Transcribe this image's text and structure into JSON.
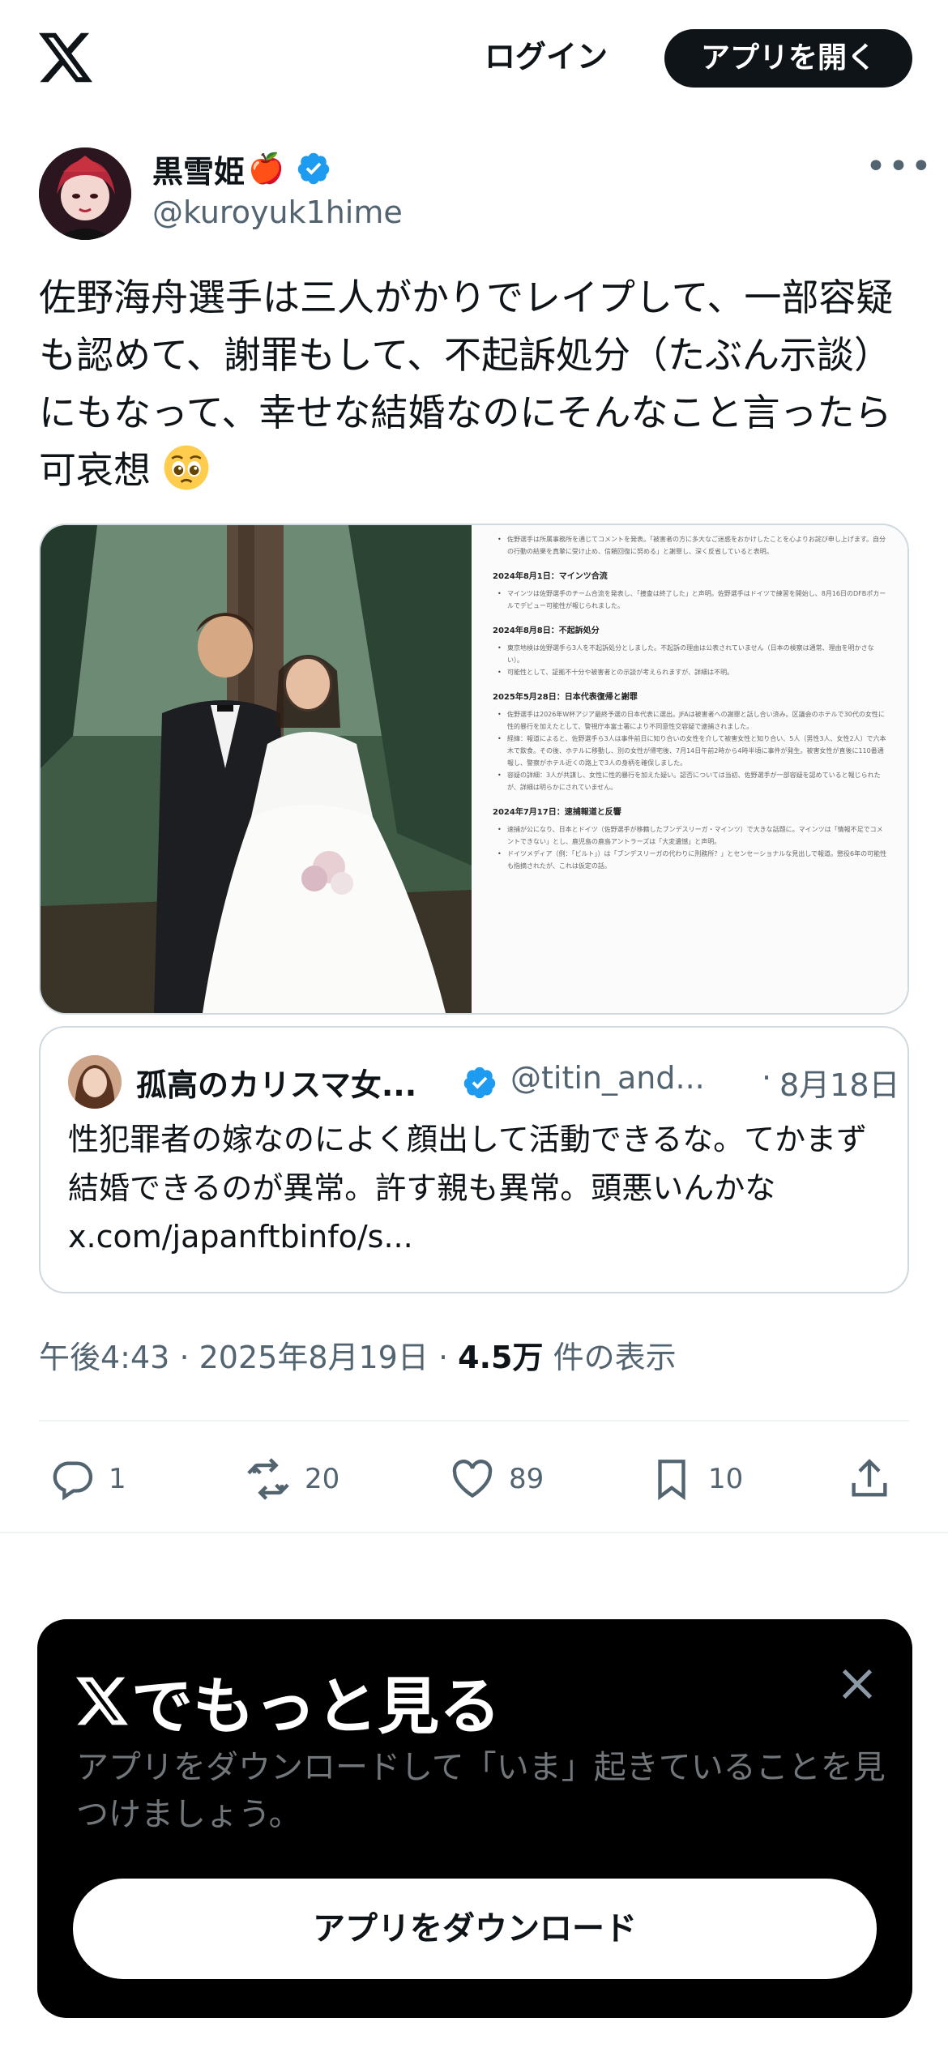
{
  "header": {
    "logo_icon": "x-logo-icon",
    "login_label": "ログイン",
    "open_app_label": "アプリを開く"
  },
  "tweet": {
    "author_name": "黒雪姫",
    "author_emoji": "🍎",
    "author_handle": "@kuroyuk1hime",
    "text_main": "佐野海舟選手は三人がかりでレイプして、一部容疑も認めて、謝罪もして、不起訴処分（たぶん示談）にもなって、幸せな結婚なのにそんなこと言ったら可哀想",
    "text_emoji": "pleading-face-emoji",
    "time": "午後4:43",
    "date": "2025年8月19日",
    "views_count": "4.5万",
    "views_label": "件の表示",
    "sep": "·"
  },
  "media_doc": {
    "lines": [
      {
        "kind": "p",
        "text": "佐野選手は所属事務所を通じてコメントを発表。「被害者の方に多大なご迷惑をおかけしたことを心よりお詫び申し上げます。自分の行動の結果を真摯に受け止め、信頼回復に努める」と謝罪し、深く反省していると表明。"
      },
      {
        "kind": "h",
        "text": "2024年8月1日：マインツ合流"
      },
      {
        "kind": "p",
        "text": "マインツは佐野選手のチーム合流を発表し、「捜査は終了した」と声明。佐野選手はドイツで練習を開始し、8月16日のDFBポカールでデビュー可能性が報じられました。"
      },
      {
        "kind": "h",
        "text": "2024年8月8日：不起訴処分"
      },
      {
        "kind": "p",
        "text": "東京地検は佐野選手ら3人を不起訴処分としました。不起訴の理由は公表されていません（日本の検察は通常、理由を明かさない）。"
      },
      {
        "kind": "p",
        "text": "可能性として、証拠不十分や被害者との示談が考えられますが、詳細は不明。"
      },
      {
        "kind": "h",
        "text": "2025年5月28日：日本代表復帰と謝罪"
      },
      {
        "kind": "p",
        "text": "佐野選手は2026年W杯アジア最終予選の日本代表に選出。JFAは被害者への謝罪と話し合い済み。区議会のホテルで30代の女性に性的暴行を加えたとして、警視庁本富士署により不同意性交容疑で逮捕されました。"
      },
      {
        "kind": "p",
        "text": "経緯：報道によると、佐野選手ら3人は事件前日に知り合いの女性を介して被害女性と知り合い、5人（男性3人、女性2人）で六本木で飲食。その後、ホテルに移動し、別の女性が帰宅後、7月14日午前2時から4時半頃に事件が発生。被害女性が直後に110番通報し、警察がホテル近くの路上で3人の身柄を確保しました。"
      },
      {
        "kind": "p",
        "text": "容疑の詳細：3人が共謀し、女性に性的暴行を加えた疑い。認否については当初、佐野選手が一部容疑を認めていると報じられたが、詳細は明らかにされていません。"
      },
      {
        "kind": "h",
        "text": "2024年7月17日：速捕報道と反響"
      },
      {
        "kind": "p",
        "text": "速捕が公になり、日本とドイツ（佐野選手が移籍したブンデスリーガ・マインツ）で大きな話題に。マインツは「情報不足でコメントできない」とし、鹿児島の鹿島アントラーズは「大変遺憾」と声明。"
      },
      {
        "kind": "p",
        "text": "ドイツメディア（例：「ビルト」）は「ブンデスリーガの代わりに刑務所？」とセンセーショナルな見出しで報道。懲役6年の可能性も指摘されたが、これは仮定の話。"
      }
    ]
  },
  "quote": {
    "author_name": "孤高のカリスマ女...",
    "author_handle": "@titin_and...",
    "sep": "·",
    "date": "8月18日",
    "text": "性犯罪者の嫁なのによく顔出して活動できるな。てかまず結婚できるのが異常。許す親も異常。頭悪いんかな ",
    "link": "x.com/japanftbinfo/s..."
  },
  "actions": {
    "reply_count": "1",
    "retweet_count": "20",
    "like_count": "89",
    "bookmark_count": "10"
  },
  "promo": {
    "title": "でもっと見る",
    "subtitle": "アプリをダウンロードして「いま」起きていることを見つけましょう。",
    "button_label": "アプリをダウンロード"
  },
  "colors": {
    "text_primary": "#0f1419",
    "text_secondary": "#536471",
    "verified_blue": "#1d9bf0",
    "border": "#cfd9de",
    "promo_bg": "#000000"
  }
}
